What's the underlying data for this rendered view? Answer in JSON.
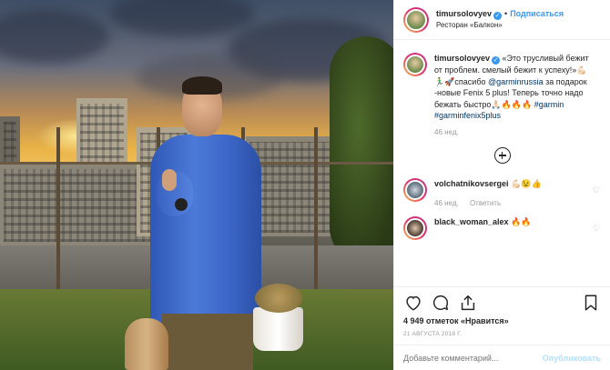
{
  "header": {
    "username": "timursolovyev",
    "follow_label": "Подписаться",
    "location": "Ресторан «Балкон»"
  },
  "caption": {
    "username": "timursolovyev",
    "text_1": "«Это трусливый бежит от проблем. смелый бежит к успеху!»",
    "emoji_1": "💪🏻🏃‍♂️🚀",
    "text_2": "спасибо ",
    "mention": "@garminrussia",
    "text_3": " за подарок -новые Fenix 5 plus! Теперь точно надо бежать быстро",
    "emoji_2": "🙏🏻🔥🔥🔥",
    "tag_1": "#garmin",
    "tag_2": "#garminfenix5plus",
    "age": "46 нед."
  },
  "comments": [
    {
      "username": "volchatnikovsergei",
      "text": "💪🏻😉👍",
      "age": "46 нед.",
      "reply_label": "Ответить"
    },
    {
      "username": "black_woman_alex",
      "text": "🔥🔥",
      "age": "",
      "reply_label": ""
    }
  ],
  "actions": {
    "likes": "4 949 отметок «Нравится»",
    "date": "21 августа 2018 г."
  },
  "add_comment": {
    "placeholder": "Добавьте комментарий...",
    "post_label": "Опубликовать"
  },
  "colors": {
    "accent": "#3897f0",
    "post_disabled": "#b2dffc",
    "muted": "#999999"
  }
}
